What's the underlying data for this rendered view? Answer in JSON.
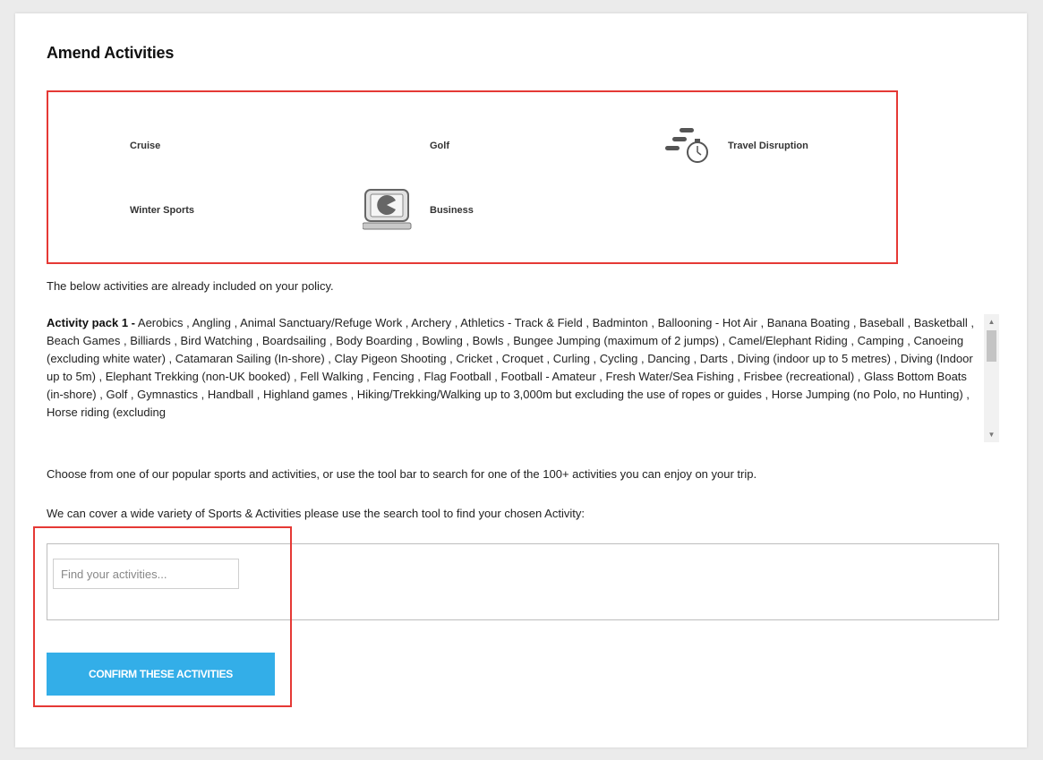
{
  "page": {
    "title": "Amend Activities"
  },
  "categories": {
    "items": [
      {
        "label": "Cruise",
        "icon": "none"
      },
      {
        "label": "Golf",
        "icon": "none"
      },
      {
        "label": "Travel Disruption",
        "icon": "stopwatch-icon"
      },
      {
        "label": "Winter Sports",
        "icon": "none"
      },
      {
        "label": "Business",
        "icon": "laptop-pie-icon"
      }
    ]
  },
  "included": {
    "intro": "The below activities are already included on your policy.",
    "pack_label": "Activity pack 1 -",
    "pack_list": " Aerobics , Angling , Animal Sanctuary/Refuge Work , Archery , Athletics - Track & Field , Badminton , Ballooning - Hot Air , Banana Boating , Baseball , Basketball , Beach Games , Billiards , Bird Watching , Boardsailing , Body Boarding , Bowling , Bowls , Bungee Jumping (maximum of 2 jumps) , Camel/Elephant Riding , Camping , Canoeing (excluding white water) , Catamaran Sailing (In-shore) , Clay Pigeon Shooting , Cricket , Croquet , Curling , Cycling , Dancing , Darts , Diving (indoor up to 5 metres) , Diving (Indoor up to 5m) , Elephant Trekking (non-UK booked) , Fell Walking , Fencing , Flag Football , Football - Amateur , Fresh Water/Sea Fishing , Frisbee (recreational) , Glass Bottom Boats (in-shore) , Golf , Gymnastics , Handball , Highland games , Hiking/Trekking/Walking up to 3,000m but excluding the use of ropes or guides , Horse Jumping (no Polo, no Hunting) , Horse riding (excluding"
  },
  "search": {
    "choose_text": "Choose from one of our popular sports and activities, or use the tool bar to search for one of the 100+ activities you can enjoy on your trip.",
    "cover_text": "We can cover a wide variety of Sports & Activities please use the search tool to find your chosen Activity:",
    "placeholder": "Find your activities..."
  },
  "actions": {
    "confirm_label": "CONFIRM THESE ACTIVITIES"
  },
  "colors": {
    "accent": "#33aee8",
    "highlight": "#e53935"
  }
}
